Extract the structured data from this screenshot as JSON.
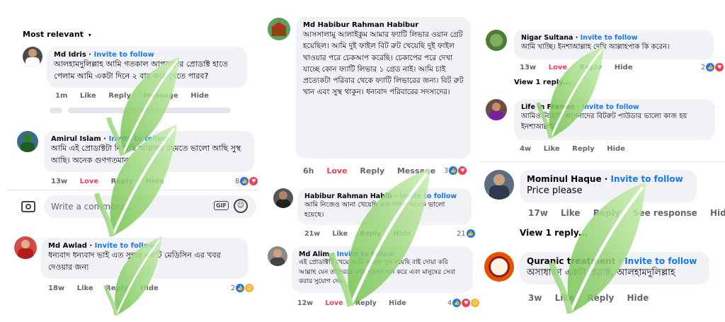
{
  "left": {
    "sort_label": "Most relevant",
    "comment_input_placeholder": "Write a comment...",
    "comments": [
      {
        "name": "Md Idris",
        "invite": "Invite to follow",
        "text": "আলহামদুলিল্লাহ আমি গতকাল আপনাদের প্রোডাক্ট হাতে পেলাম আমি একটা দিনে ২ বার করে খেতে পারব?",
        "time": "1m",
        "like": "Like",
        "reply": "Reply",
        "message": "Message",
        "hide": "Hide"
      },
      {
        "name": "Amirul Islam",
        "invite": "Invite to follow",
        "text": "আমি এই প্রোডাক্টটা নিয়েছি আল্লাহর রহমতে ভালো আছি সুস্থ আছি। অনেক গুণগতমান",
        "time": "13w",
        "love": "Love",
        "reply": "Reply",
        "hide": "Hide",
        "count": "8"
      },
      {
        "name": "Md Awlad",
        "invite": "Invite to follow",
        "text": "ধন্যবাদ ধন্যবাদ ভাই এত সুন্দর একটি মেডিসিন এর খবর দেওয়ার জন্য",
        "time": "18w",
        "like": "Like",
        "reply": "Reply",
        "hide": "Hide",
        "count": "2"
      }
    ]
  },
  "middle": {
    "comments": [
      {
        "name": "Md Habibur Rahman Habibur",
        "text": "আসসালামু আলাইকুম আমার ফ্যাটি লিভার ওয়ান গ্রেট হয়েছিল। আমি দুই ফাইল বিট রুট খেয়েছি দুই ফাইল খাওয়ার পরে চেকআপ করেছি। চেকাপের পরে দেখা যাচ্ছে কোন ফ্যাটি লিভার ১ গ্রেড নাই। আমি চাই প্রত্যেকটা পরিবার থেকে ফ্যাটি লিভারের জন্য। বিট রুট খান এবং সুস্থ থাকুন। ধন্যবাদ পরিবারের সদস্যদের।",
        "time": "6h",
        "love": "Love",
        "reply": "Reply",
        "message": "Message",
        "count": "3"
      },
      {
        "name": "Habibur Rahman Habib",
        "invite": "Invite to follow",
        "text": "আমি নিজেও আনা খেয়েছি এক পাইল অনেক ভালো হয়েছে।",
        "time": "21w",
        "like": "Like",
        "reply": "Reply",
        "hide": "Hide",
        "count": "21"
      },
      {
        "name": "Md Alim",
        "invite": "Invite to follow",
        "text": "এই প্রোডাক্টটি খেয়ে আমি অনেক সুস্থ হয়েছি বাই দোয়া করি আল্লাহ যেন তাদেরকে নেক হায়াত দান করে এবং মানুষের সেবা করার সুযোগ দেয়",
        "time": "12w",
        "love": "Love",
        "reply": "Reply",
        "hide": "Hide",
        "count": "4"
      }
    ]
  },
  "right": {
    "view_reply": "View 1 reply...",
    "view_reply_2": "View 1 reply...",
    "comments": [
      {
        "name": "Nigar Sultana",
        "invite": "Invite to follow",
        "text": "আমি খাচ্ছি। ইনশাআল্লাহ দেখি আল্লাহপাক কি করেন।",
        "time": "13w",
        "love": "Love",
        "reply": "Reply",
        "hide": "Hide",
        "count": "2"
      },
      {
        "name": "Life in Frames",
        "invite": "Invite to follow",
        "text": "আমিও নিয়েছি আপনাদের বিটরুট পাউডার ভালো কাজ হয় ইনশাআল্লাহ",
        "time": "4w",
        "like": "Like",
        "reply": "Reply",
        "hide": "Hide"
      },
      {
        "name": "Mominul Haque",
        "invite": "Invite to follow",
        "text": "Price please",
        "time": "17w",
        "like": "Like",
        "reply": "Reply",
        "see_response": "See response",
        "hide": "Hid"
      },
      {
        "name": "Quranic treatment",
        "invite": "Invite to follow",
        "text": "অসাধারণ একটা প্রডাক্ট, আলহামদুলিল্লাহ",
        "time": "3w",
        "like": "Like",
        "reply": "Reply",
        "hide": "Hide"
      }
    ]
  },
  "colors": {
    "invite": "#1877f2",
    "love": "#f33e58",
    "bubble": "#f0f2f5",
    "leaf": "#8fd16a"
  },
  "icons": [
    "chevron-down-icon",
    "camera-icon",
    "gif-icon",
    "emoji-icon",
    "like-reaction-icon",
    "heart-reaction-icon",
    "care-reaction-icon",
    "leaf-watermark"
  ]
}
